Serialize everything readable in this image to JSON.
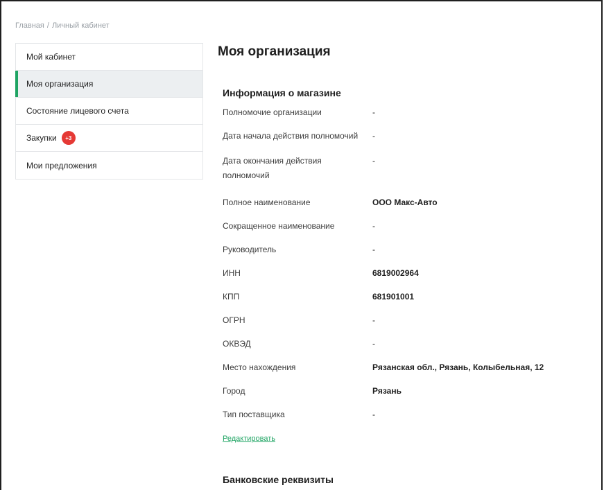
{
  "breadcrumb": {
    "home": "Главная",
    "separator": "/",
    "current": "Личный кабинет"
  },
  "sidebar": {
    "items": [
      {
        "label": "Мой кабинет"
      },
      {
        "label": "Моя организация"
      },
      {
        "label": "Состояние лицевого счета"
      },
      {
        "label": "Закупки",
        "badge": "+3"
      },
      {
        "label": "Мои предложения"
      }
    ],
    "active_index": 1
  },
  "main": {
    "title": "Моя организация",
    "store_section_title": "Информация о магазине",
    "bank_section_title": "Банковские реквизиты",
    "edit_link": "Редактировать",
    "fields": [
      {
        "label": "Полномочие организации",
        "value": "-"
      },
      {
        "label": "Дата начала действия полномочий",
        "value": "-"
      },
      {
        "label": "Дата окончания действия полномочий",
        "value": "-"
      },
      {
        "label": "Полное наименование",
        "value": "ООО Макс-Авто"
      },
      {
        "label": "Сокращенное наименование",
        "value": "-"
      },
      {
        "label": "Руководитель",
        "value": "-"
      },
      {
        "label": "ИНН",
        "value": "6819002964"
      },
      {
        "label": "КПП",
        "value": "681901001"
      },
      {
        "label": "ОГРН",
        "value": "-"
      },
      {
        "label": "ОКВЭД",
        "value": "-"
      },
      {
        "label": "Место нахождения",
        "value": "Рязанская обл., Рязань, Колыбельная, 12"
      },
      {
        "label": "Город",
        "value": "Рязань"
      },
      {
        "label": "Тип поставщика",
        "value": "-"
      }
    ]
  },
  "colors": {
    "accent": "#1fa463",
    "badge": "#e53935",
    "active_bg": "#eceff1"
  }
}
